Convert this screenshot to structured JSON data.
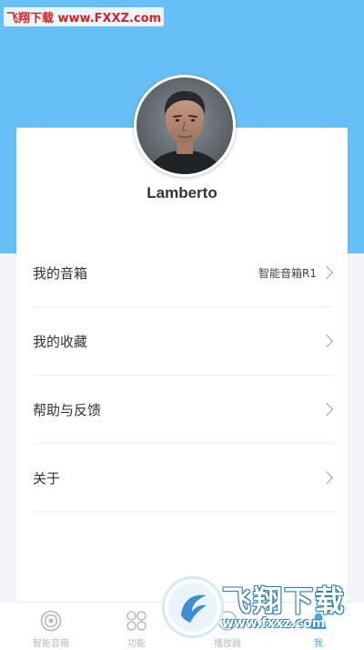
{
  "watermark": {
    "top_text": "飞翔下载 www.FXXZ.com",
    "bottom_title": "飞翔下载",
    "bottom_url": "www.fxxz.com"
  },
  "profile": {
    "username": "Lamberto"
  },
  "menu": [
    {
      "label": "我的音箱",
      "value": "智能音箱R1"
    },
    {
      "label": "我的收藏",
      "value": ""
    },
    {
      "label": "帮助与反馈",
      "value": ""
    },
    {
      "label": "关于",
      "value": ""
    }
  ],
  "tabbar": {
    "items": [
      {
        "label": "智能音箱",
        "icon": "speaker-icon",
        "active": false
      },
      {
        "label": "功能",
        "icon": "grid-circles-icon",
        "active": false
      },
      {
        "label": "播放器",
        "icon": "player-icon",
        "active": false
      },
      {
        "label": "我",
        "icon": "person-icon",
        "active": true
      }
    ]
  },
  "colors": {
    "header_blue": "#66bff6",
    "active_tab": "#4aa8ee",
    "inactive_tab": "#b4bac2"
  }
}
